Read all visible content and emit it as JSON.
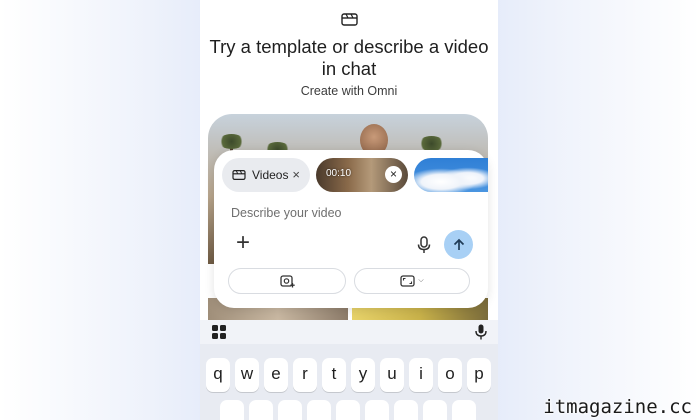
{
  "header": {
    "icon": "video-clapper-icon",
    "title": "Try a template or describe a video in chat",
    "subtitle": "Create with Omni"
  },
  "prompt": {
    "chips": [
      {
        "label": "Videos",
        "icon": "video-clapper-icon",
        "close": "×"
      },
      {
        "time": "00:10",
        "close": "×"
      }
    ],
    "placeholder": "Describe your video",
    "add_icon": "+",
    "mic_icon": "microphone-icon",
    "send_icon": "arrow-up-icon",
    "options": [
      {
        "icon": "image-add-icon"
      },
      {
        "icon": "aspect-ratio-icon",
        "chevron": "⌵"
      }
    ]
  },
  "keyboard": {
    "row1": [
      "q",
      "w",
      "e",
      "r",
      "t",
      "y",
      "u",
      "i",
      "o",
      "p"
    ]
  },
  "watermark": "itmagazine.cc",
  "colors": {
    "send_button": "#a8d0f5",
    "chip_background": "#e9ebef",
    "keyboard_background": "#e8ebf2"
  }
}
